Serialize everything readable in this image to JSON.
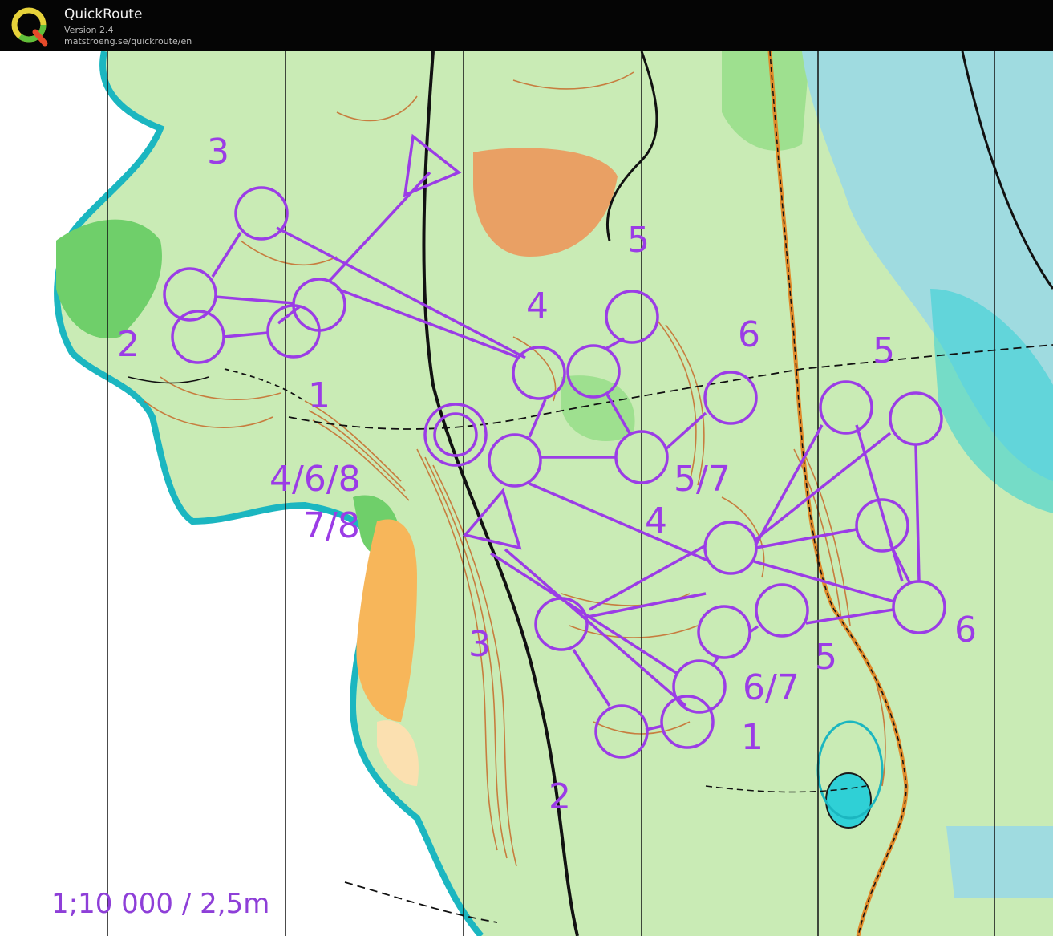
{
  "app": {
    "title": "QuickRoute",
    "version": "Version 2.4",
    "url": "matstroeng.se/quickroute/en"
  },
  "map": {
    "scale": "1;10 000 / 2,5m",
    "course_color": "#9b3ce6",
    "colors": {
      "forest_light": "#c9ebb5",
      "forest_dark": "#6fcf6a",
      "open_land": "#f7c46a",
      "rough_open": "#fbe0b0",
      "water": "#2fd0d6",
      "marsh": "#9fdbe0",
      "contour": "#c76a2a",
      "track": "#111111"
    },
    "control_labels": [
      "3",
      "2",
      "1",
      "4/6/8",
      "7/8",
      "4",
      "5",
      "6",
      "5",
      "5/7",
      "4",
      "3",
      "6/7",
      "5",
      "6",
      "1",
      "2"
    ]
  }
}
